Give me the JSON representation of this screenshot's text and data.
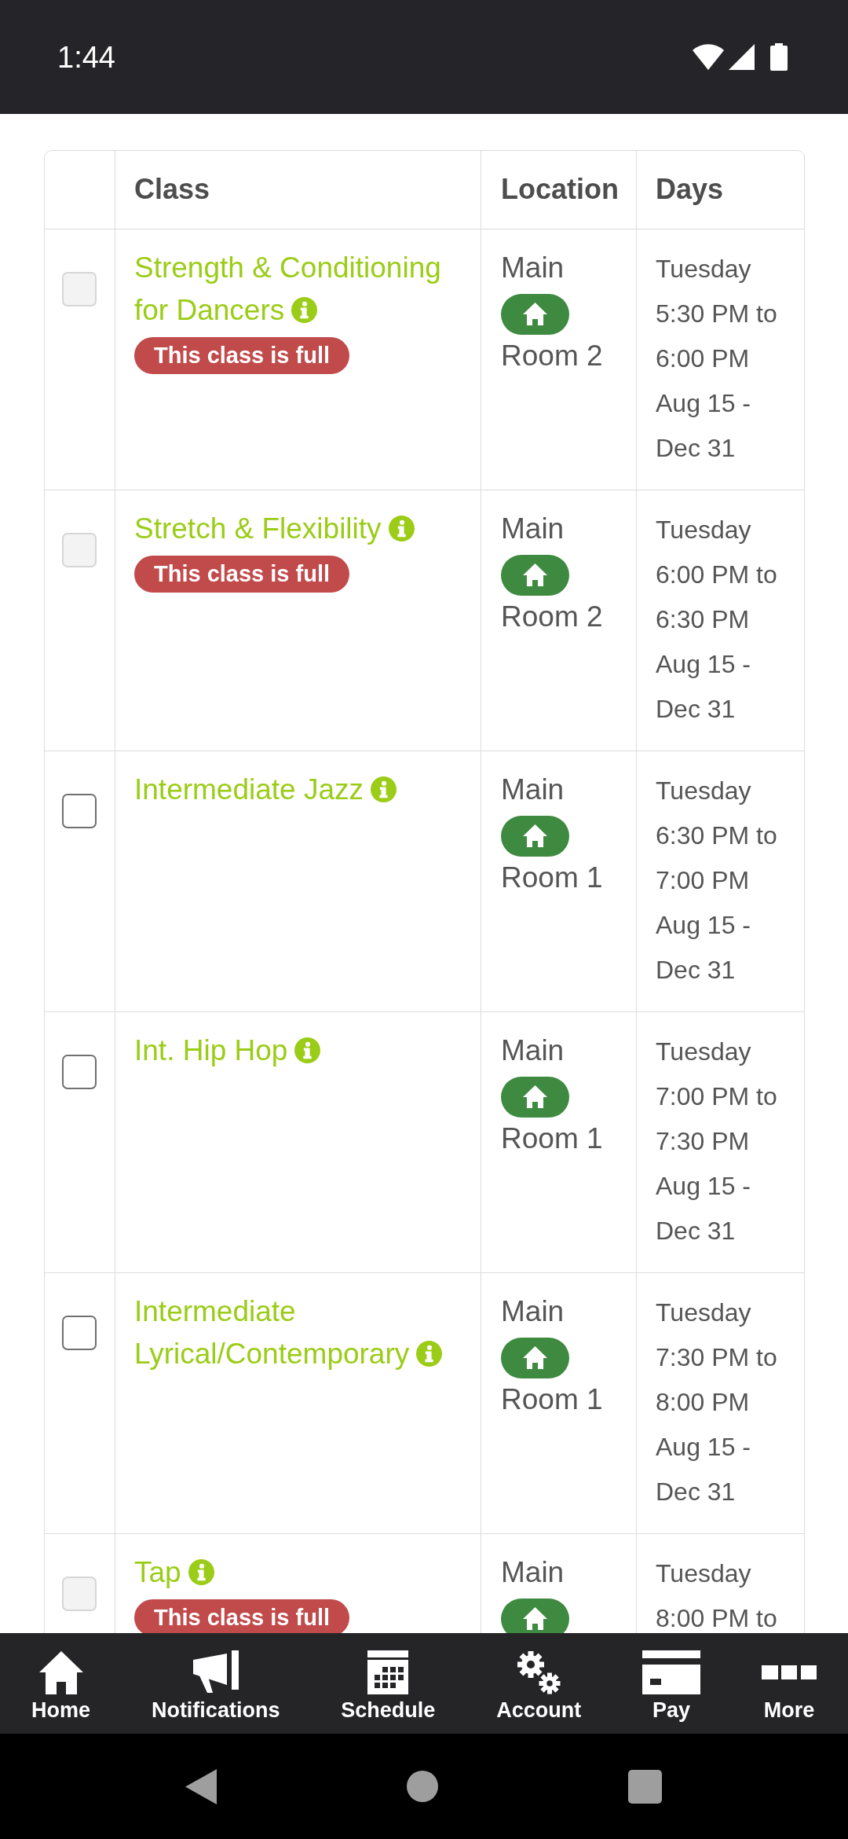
{
  "status_bar": {
    "time": "1:44"
  },
  "table": {
    "columns": [
      "Class",
      "Location",
      "Days"
    ],
    "rows": [
      {
        "checked": false,
        "disabled": true,
        "name": "Strength & Conditioning for Dancers",
        "badge": "This class is full",
        "location": "Main",
        "room": "Room 2",
        "day": "Tuesday",
        "time": "5:30 PM to 6:00 PM",
        "dates": "Aug 15 - Dec 31"
      },
      {
        "checked": false,
        "disabled": true,
        "name": "Stretch & Flexibility",
        "badge": "This class is full",
        "location": "Main",
        "room": "Room 2",
        "day": "Tuesday",
        "time": "6:00 PM to 6:30 PM",
        "dates": "Aug 15 - Dec 31"
      },
      {
        "checked": false,
        "disabled": false,
        "name": "Intermediate Jazz",
        "location": "Main",
        "room": "Room 1",
        "day": "Tuesday",
        "time": "6:30 PM to 7:00 PM",
        "dates": "Aug 15 - Dec 31"
      },
      {
        "checked": false,
        "disabled": false,
        "name": "Int. Hip Hop",
        "location": "Main",
        "room": "Room 1",
        "day": "Tuesday",
        "time": "7:00 PM to 7:30 PM",
        "dates": "Aug 15 - Dec 31"
      },
      {
        "checked": false,
        "disabled": false,
        "name": "Intermediate Lyrical/Contemporary",
        "location": "Main",
        "room": "Room 1",
        "day": "Tuesday",
        "time": "7:30 PM to 8:00 PM",
        "dates": "Aug 15 - Dec 31"
      },
      {
        "checked": false,
        "disabled": true,
        "name": "Tap",
        "badge": "This class is full",
        "location": "Main",
        "day": "Tuesday",
        "time": "8:00 PM to"
      }
    ]
  },
  "bottom_nav": [
    {
      "label": "Home"
    },
    {
      "label": "Notifications"
    },
    {
      "label": "Schedule"
    },
    {
      "label": "Account"
    },
    {
      "label": "Pay"
    },
    {
      "label": "More"
    }
  ]
}
